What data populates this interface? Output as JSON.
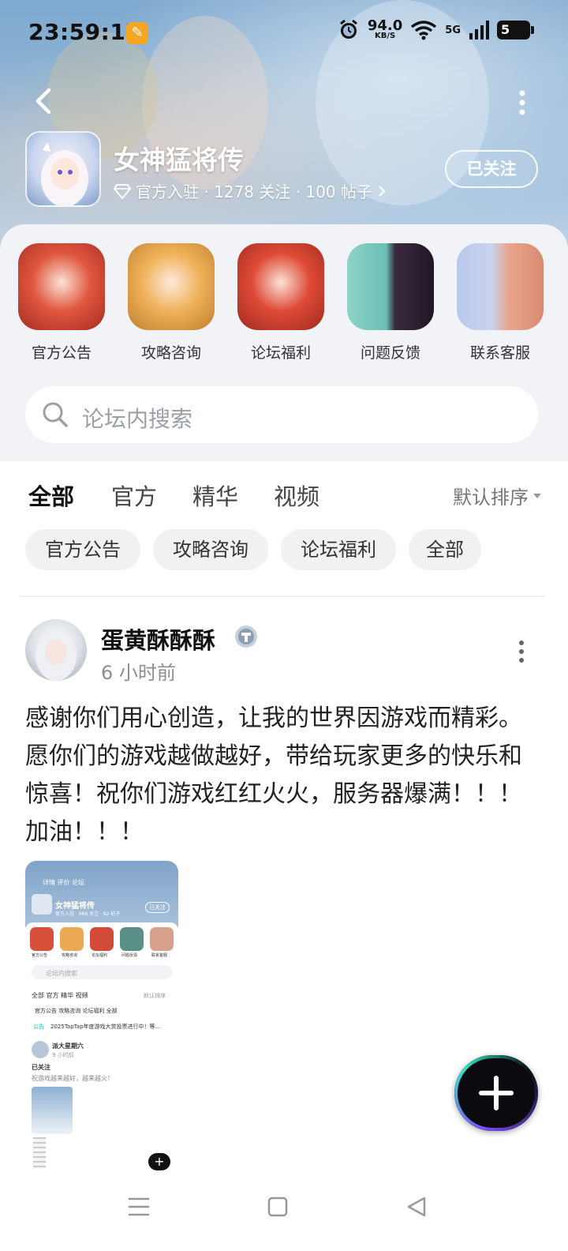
{
  "status_bar": {
    "time": "23:59:17",
    "net_speed": "94.0",
    "net_unit": "KB/S",
    "signal": "5G",
    "battery": "5"
  },
  "header": {
    "game_title": "女神猛将传",
    "meta": "官方入驻 · 1278 关注 · 100 帖子",
    "follow_label": "已关注"
  },
  "shortcuts": [
    {
      "label": "官方公告"
    },
    {
      "label": "攻略咨询"
    },
    {
      "label": "论坛福利"
    },
    {
      "label": "问题反馈"
    },
    {
      "label": "联系客服"
    }
  ],
  "search": {
    "placeholder": "论坛内搜索"
  },
  "tabs": [
    {
      "label": "全部",
      "active": true
    },
    {
      "label": "官方"
    },
    {
      "label": "精华"
    },
    {
      "label": "视频"
    }
  ],
  "sort_label": "默认排序",
  "chips": [
    "官方公告",
    "攻略咨询",
    "论坛福利",
    "全部"
  ],
  "post": {
    "author": "蛋黄酥酥酥",
    "time": "6 小时前",
    "body": "感谢你们用心创造，让我的世界因游戏而精彩。愿你们的游戏越做越好，带给玩家更多的快乐和惊喜！祝你们游戏红红火火，服务器爆满！！！加油！！！",
    "image": {
      "tabs": "详情  评价  论坛",
      "title": "女神猛将传",
      "meta": "官方入驻 · 966 关注 · 92 帖子",
      "follow": "已关注",
      "shortcut_labels": [
        "官方公告",
        "攻略咨询",
        "论坛福利",
        "问题反馈",
        "联系客服"
      ],
      "search": "论坛内搜索",
      "tab_row": "全部   官方   精华   视频",
      "sort": "默认排序",
      "chip_row": "官方公告   攻略咨询   论坛福利   全部",
      "notice_tag": "公告",
      "notice": "2025TapTap年度游戏大赏投票进行中！等...",
      "author": "派大星期六",
      "time": "9 小时前",
      "post_title": "已关注",
      "post_text": "祝游戏越来越好，越来越火！"
    }
  },
  "colors": {
    "accent": "#19c6b4",
    "fab_bg": "#0b0b0f",
    "sheet_bg": "#f1f3f6"
  }
}
